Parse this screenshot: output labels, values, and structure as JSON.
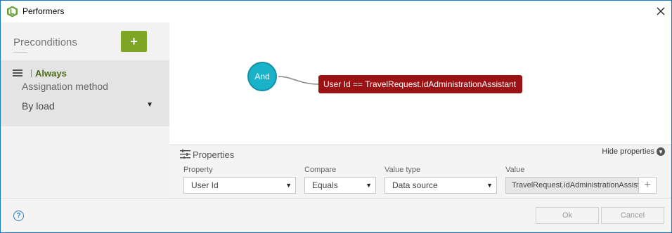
{
  "window": {
    "title": "Performers"
  },
  "sidebar": {
    "title": "Preconditions",
    "add_label": "+",
    "precondition": {
      "name": "Always",
      "field_label": "Assignation method",
      "method_value": "By load"
    }
  },
  "canvas": {
    "and_label": "And",
    "condition_label": "User Id == TravelRequest.idAdministrationAssistant"
  },
  "properties": {
    "title": "Properties",
    "hide_label": "Hide properties",
    "property": {
      "label": "Property",
      "value": "User Id"
    },
    "compare": {
      "label": "Compare",
      "value": "Equals"
    },
    "value_type": {
      "label": "Value type",
      "value": "Data source"
    },
    "value": {
      "label": "Value",
      "value": "TravelRequest.idAdministrationAssistant"
    },
    "add_value_label": "+"
  },
  "footer": {
    "help_label": "?",
    "ok_label": "Ok",
    "cancel_label": "Cancel"
  },
  "colors": {
    "accent_green": "#7fa526",
    "node_teal": "#1ab2c9",
    "condition_red": "#9b1114",
    "window_border": "#1979ca"
  },
  "icons": {
    "app": "app-logo-icon",
    "close": "close-icon",
    "list": "list-icon",
    "properties": "sliders-icon",
    "chevron": "chevron-down-icon",
    "help": "help-icon"
  }
}
